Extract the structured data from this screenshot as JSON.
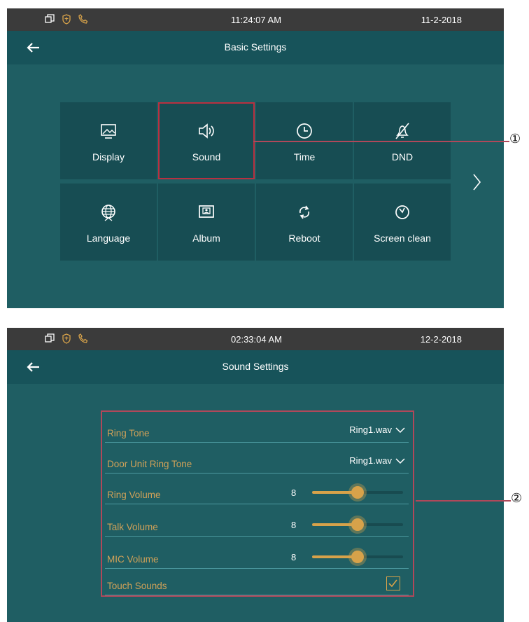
{
  "screen1": {
    "status": {
      "time": "11:24:07   AM",
      "date": "11-2-2018"
    },
    "title": "Basic Settings",
    "tiles": [
      {
        "label": "Display",
        "icon": "display-icon"
      },
      {
        "label": "Sound",
        "icon": "sound-icon",
        "selected": true
      },
      {
        "label": "Time",
        "icon": "clock-icon"
      },
      {
        "label": "DND",
        "icon": "dnd-icon"
      },
      {
        "label": "Language",
        "icon": "globe-icon"
      },
      {
        "label": "Album",
        "icon": "album-icon"
      },
      {
        "label": "Reboot",
        "icon": "reboot-icon"
      },
      {
        "label": "Screen clean",
        "icon": "timer-icon"
      }
    ],
    "callout": "①"
  },
  "screen2": {
    "status": {
      "time": "02:33:04   AM",
      "date": "12-2-2018"
    },
    "title": "Sound Settings",
    "rows": [
      {
        "label": "Ring Tone",
        "value": "Ring1.wav"
      },
      {
        "label": "Door Unit Ring Tone",
        "value": "Ring1.wav"
      },
      {
        "label": "Ring Volume",
        "value": "8",
        "level": 0.5
      },
      {
        "label": "Talk Volume",
        "value": "8",
        "level": 0.5
      },
      {
        "label": "MIC Volume",
        "value": "8",
        "level": 0.5
      },
      {
        "label": "Touch Sounds",
        "checked": true
      }
    ],
    "callout": "②"
  },
  "colors": {
    "screen_bg": "#1f5e63",
    "tile_bg": "#174d53",
    "accent": "#d7a24a",
    "highlight": "#b0485a"
  }
}
